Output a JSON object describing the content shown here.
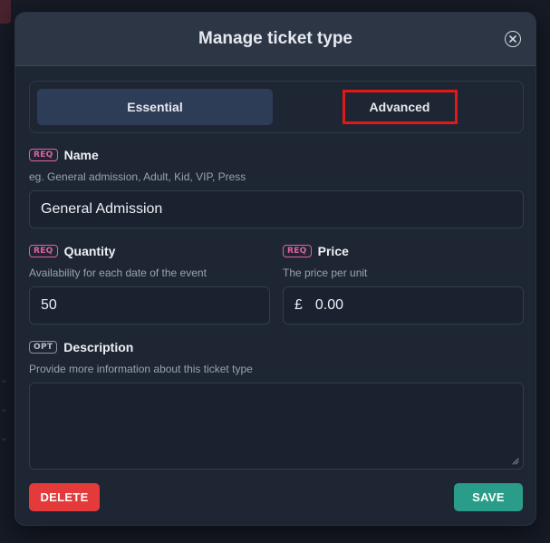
{
  "modal": {
    "title": "Manage ticket type"
  },
  "tabs": [
    {
      "label": "Essential",
      "active": true
    },
    {
      "label": "Advanced",
      "active": false,
      "highlighted": true
    }
  ],
  "fields": {
    "name": {
      "badge": "REQ",
      "label": "Name",
      "hint": "eg. General admission, Adult, Kid, VIP, Press",
      "value": "General Admission"
    },
    "quantity": {
      "badge": "REQ",
      "label": "Quantity",
      "hint": "Availability for each date of the event",
      "value": "50"
    },
    "price": {
      "badge": "REQ",
      "label": "Price",
      "hint": "The price per unit",
      "currency": "£",
      "value": "0.00"
    },
    "description": {
      "badge": "OPT",
      "label": "Description",
      "hint": "Provide more information about this ticket type",
      "value": ""
    }
  },
  "buttons": {
    "delete": "DELETE",
    "save": "SAVE"
  },
  "colors": {
    "accent_active_tab": "#2e3d57",
    "req_badge": "#e061a2",
    "delete": "#e53a3a",
    "save": "#2a9d8a",
    "highlight_box": "#e01818"
  },
  "icons": {
    "close": "close-circle-icon",
    "resize": "resize-handle-icon"
  }
}
